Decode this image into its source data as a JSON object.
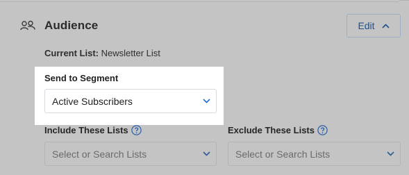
{
  "audience": {
    "title": "Audience",
    "edit_label": "Edit",
    "current_list_key": "Current List:",
    "current_list_value": "Newsletter List"
  },
  "segment": {
    "label": "Send to Segment",
    "value": "Active Subscribers"
  },
  "include_lists": {
    "label": "Include These Lists",
    "placeholder": "Select or Search Lists"
  },
  "exclude_lists": {
    "label": "Exclude These Lists",
    "placeholder": "Select or Search Lists"
  },
  "colors": {
    "dimmed_overlay": "#c4c4c4",
    "highlight": "#ffffff",
    "accent": "#1f6fd6",
    "edit_text": "#1f4f8c"
  },
  "icons": {
    "audience": "users-icon",
    "edit": "chevron-up-icon",
    "dropdown": "chevron-down-icon",
    "help": "question-circle-icon"
  }
}
